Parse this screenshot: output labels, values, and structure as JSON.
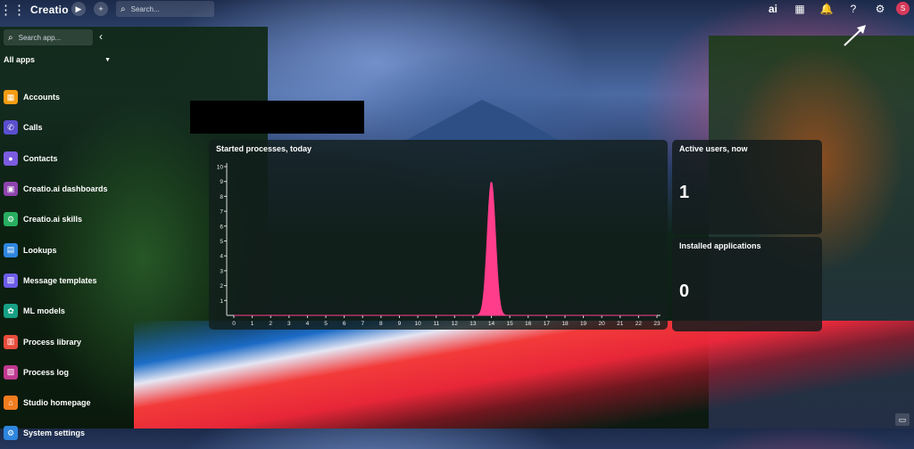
{
  "topbar": {
    "app_name": "Creatio",
    "search_placeholder": "Search...",
    "ai_label": "ai",
    "avatar_initial": "S"
  },
  "sidebar": {
    "search_placeholder": "Search app...",
    "all_apps_label": "All apps",
    "items": [
      {
        "label": "Accounts",
        "icon": "accounts-icon",
        "color": "#f39c12",
        "glyph": "▦"
      },
      {
        "label": "Calls",
        "icon": "phone-icon",
        "color": "#5b4fcf",
        "glyph": "✆"
      },
      {
        "label": "Contacts",
        "icon": "contact-icon",
        "color": "#7b5be0",
        "glyph": "●"
      },
      {
        "label": "Creatio.ai dashboards",
        "icon": "ai-dashboard-icon",
        "color": "#8e44ad",
        "glyph": "▣"
      },
      {
        "label": "Creatio.ai skills",
        "icon": "ai-skills-icon",
        "color": "#27ae60",
        "glyph": "⚙"
      },
      {
        "label": "Lookups",
        "icon": "book-icon",
        "color": "#2e86de",
        "glyph": "▤"
      },
      {
        "label": "Message templates",
        "icon": "template-icon",
        "color": "#6c5ce7",
        "glyph": "▧"
      },
      {
        "label": "ML models",
        "icon": "ml-icon",
        "color": "#16a085",
        "glyph": "✿"
      },
      {
        "label": "Process library",
        "icon": "process-icon",
        "color": "#e74c3c",
        "glyph": "▥"
      },
      {
        "label": "Process log",
        "icon": "log-icon",
        "color": "#c0398f",
        "glyph": "▨"
      },
      {
        "label": "Studio homepage",
        "icon": "home-icon",
        "color": "#f07c1e",
        "glyph": "⌂"
      },
      {
        "label": "System settings",
        "icon": "settings-icon",
        "color": "#2e86de",
        "glyph": "⚙"
      }
    ]
  },
  "panels": {
    "started_title": "Started processes, today",
    "active_title": "Active users, now",
    "active_value": "1",
    "installed_title": "Installed applications",
    "installed_value": "0"
  },
  "chart_data": {
    "type": "area",
    "title": "Started processes, today",
    "x": [
      0,
      1,
      2,
      3,
      4,
      5,
      6,
      7,
      8,
      9,
      10,
      11,
      12,
      13,
      14,
      15,
      16,
      17,
      18,
      19,
      20,
      21,
      22,
      23
    ],
    "values": [
      0,
      0,
      0,
      0,
      0,
      0,
      0,
      0,
      0,
      0,
      0,
      0,
      0,
      0,
      9,
      0,
      0,
      0,
      0,
      0,
      0,
      0,
      0,
      0
    ],
    "ylim": [
      0,
      10
    ],
    "yticks": [
      1,
      2,
      3,
      4,
      5,
      6,
      7,
      8,
      9,
      10
    ],
    "color": "#ff3d8b",
    "grid": false
  }
}
